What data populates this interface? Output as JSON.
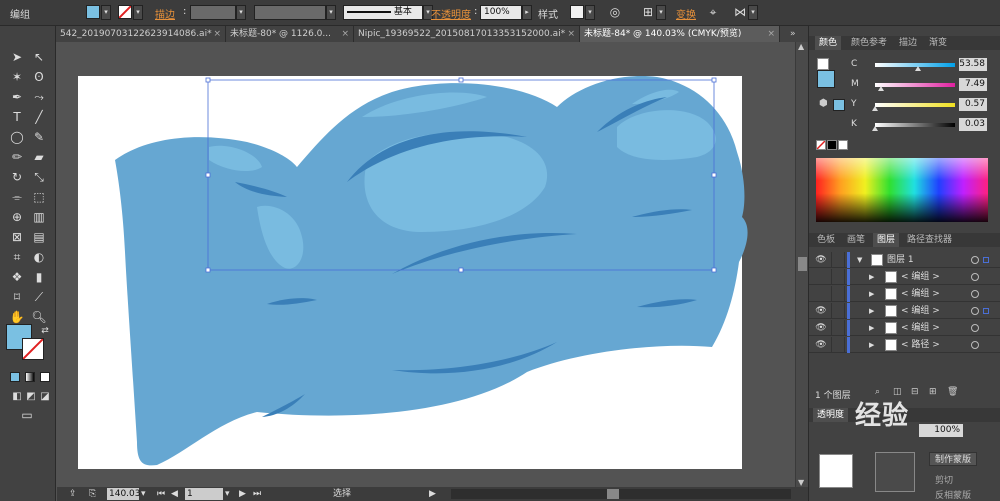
{
  "control_bar": {
    "selection_label": "编组",
    "stroke_label": "描边",
    "stroke_brush": "基本",
    "opacity_label": "不透明度",
    "opacity_value": "100%",
    "style_label": "样式",
    "transform_label": "变换",
    "fill_color": "#7ac0e2"
  },
  "tabs": [
    {
      "label": "542_20190703122623914086.ai*",
      "active": false
    },
    {
      "label": "未标题-80* @ 1126.0...",
      "active": false
    },
    {
      "label": "Nipic_19369522_20150817013353152000.ai*",
      "active": false
    },
    {
      "label": "未标题-84* @ 140.03% (CMYK/预览)",
      "active": true
    }
  ],
  "artwork": {
    "body_color": "#66a7d2",
    "highlight_color": "#79bbe0",
    "shadow_color": "#3a7fb8"
  },
  "status_bar": {
    "zoom": "140.03",
    "artboard": "1",
    "tool": "选择"
  },
  "color_panel": {
    "tabs": [
      "颜色",
      "颜色参考",
      "描边",
      "渐变"
    ],
    "channels": [
      {
        "name": "C",
        "value": "53.58",
        "fraction": 0.5358,
        "gradient": [
          "#ffffff",
          "#00a0e8"
        ]
      },
      {
        "name": "M",
        "value": "7.49",
        "fraction": 0.0749,
        "gradient": [
          "#ffffff",
          "#e020a0"
        ]
      },
      {
        "name": "Y",
        "value": "0.57",
        "fraction": 0.0057,
        "gradient": [
          "#ffffff",
          "#f0e020"
        ]
      },
      {
        "name": "K",
        "value": "0.03",
        "fraction": 0.0003,
        "gradient": [
          "#ffffff",
          "#000000"
        ]
      }
    ]
  },
  "layers_panel": {
    "tabs": [
      "色板",
      "画笔",
      "图层",
      "路径查找器"
    ],
    "layers": [
      {
        "name": "图层 1",
        "top": true,
        "eye": true
      },
      {
        "name": "< 编组 >",
        "top": false,
        "eye": false
      },
      {
        "name": "< 编组 >",
        "top": false,
        "eye": false
      },
      {
        "name": "< 编组 >",
        "top": false,
        "eye": true,
        "selected": true
      },
      {
        "name": "< 编组 >",
        "top": false,
        "eye": true
      },
      {
        "name": "< 路径 >",
        "top": false,
        "eye": true
      }
    ],
    "count_label": "1 个图层"
  },
  "transparency_panel": {
    "tab": "透明度",
    "opacity": "100%",
    "make_mask": "制作蒙版",
    "clip": "剪切",
    "invert": "反相蒙版"
  },
  "watermark": "经验"
}
